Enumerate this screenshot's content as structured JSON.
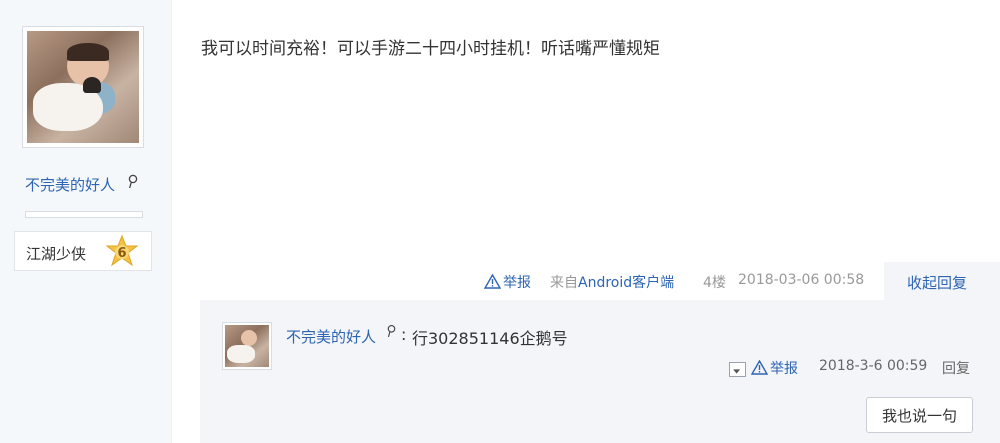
{
  "author": {
    "name": "不完美的好人",
    "level": {
      "title": "江湖少侠",
      "number": "6"
    }
  },
  "post": {
    "text": "我可以时间充裕！可以手游二十四小时挂机！听话嘴严懂规矩",
    "tail": {
      "report_label": "举报",
      "client_prefix": "来自",
      "client_name": "Android客户端",
      "floor": "4楼",
      "datetime": "2018-03-06 00:58",
      "collapse_label": "收起回复"
    }
  },
  "reply": {
    "user": "不完美的好人",
    "colon": ":",
    "text": "行302851146企鹅号",
    "report_label": "举报",
    "datetime": "2018-3-6 00:59",
    "reply_label": "回复",
    "say_button": "我也说一句"
  },
  "colors": {
    "link": "#2d64b3",
    "badge": "#f3c244",
    "panel": "#f3f5f9"
  },
  "icons": [
    "male-gender-icon",
    "warning-icon",
    "star-badge-icon",
    "chevron-down-icon"
  ]
}
